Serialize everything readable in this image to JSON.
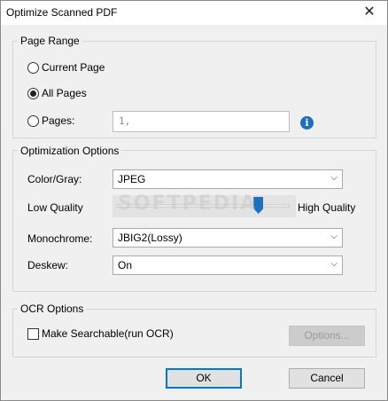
{
  "window": {
    "title": "Optimize Scanned PDF",
    "close_glyph": "✕"
  },
  "page_range": {
    "legend": "Page Range",
    "options": [
      {
        "label": "Current Page",
        "checked": false
      },
      {
        "label": "All Pages",
        "checked": true
      },
      {
        "label": "Pages:",
        "checked": false
      }
    ],
    "pages_value": "1,",
    "info_glyph": "i"
  },
  "optimization": {
    "legend": "Optimization Options",
    "color_label": "Color/Gray:",
    "color_value": "JPEG",
    "low_quality": "Low Quality",
    "high_quality": "High Quality",
    "quality_fraction": 0.82,
    "mono_label": "Monochrome:",
    "mono_value": "JBIG2(Lossy)",
    "deskew_label": "Deskew:",
    "deskew_value": "On"
  },
  "ocr": {
    "legend": "OCR Options",
    "searchable_label": "Make Searchable(run OCR)",
    "searchable_checked": false,
    "options_button": "Options..."
  },
  "footer": {
    "ok": "OK",
    "cancel": "Cancel"
  },
  "watermark": "SOFTPEDIA",
  "colors": {
    "accent": "#0078d7",
    "slider_thumb": "#1f6fbf"
  }
}
